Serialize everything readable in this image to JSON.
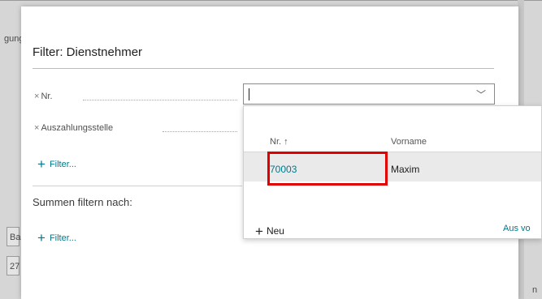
{
  "background": {
    "left_partial_text": "gung",
    "left_field_1": "Ba",
    "left_field_2": "27",
    "right_partial_text": "n"
  },
  "modal": {
    "title": "Filter: Dienstnehmer",
    "filters": [
      {
        "remove_glyph": "×",
        "label": "Nr."
      },
      {
        "remove_glyph": "×",
        "label": "Auszahlungsstelle"
      }
    ],
    "add_filter_label": "Filter...",
    "totals_section_label": "Summen filtern nach:",
    "totals_add_filter_label": "Filter..."
  },
  "input": {
    "value": "",
    "chevron_icon": "chevron-down-icon"
  },
  "dropdown": {
    "columns": [
      {
        "label": "Nr. ↑",
        "sorted": "ascending"
      },
      {
        "label": "Vorname"
      }
    ],
    "rows": [
      {
        "nr": "70003",
        "vorname": "Maxim",
        "selected": true
      }
    ],
    "new_label": "Neu",
    "show_all_label": "Aus vo"
  },
  "colors": {
    "accent": "#00788a",
    "highlight": "#e00000",
    "overlay": "#d6d6d6"
  }
}
